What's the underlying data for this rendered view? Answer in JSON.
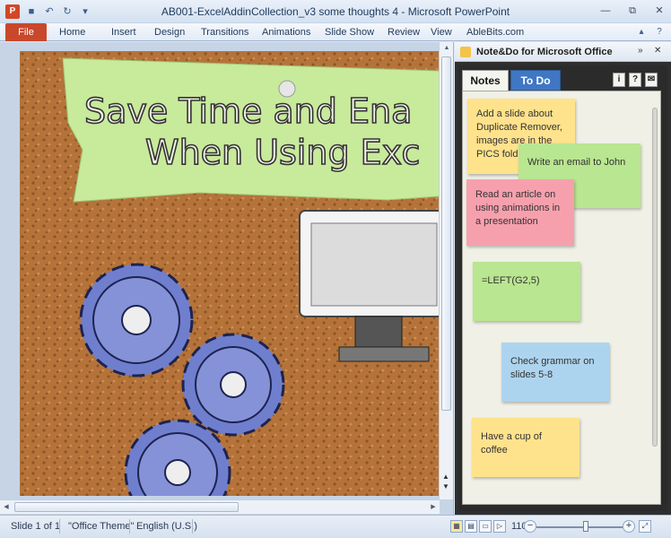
{
  "window": {
    "title": "AB001-ExcelAddinCollection_v3 some thoughts 4  -  Microsoft PowerPoint",
    "app_icon": "P"
  },
  "quick_access": {
    "icons": [
      "save-icon",
      "undo-icon",
      "redo-icon",
      "customize-qat-icon"
    ],
    "glyphs": [
      "■",
      "↶",
      "↻",
      "▾"
    ]
  },
  "window_controls": [
    "minimize-icon",
    "restore-icon",
    "close-icon"
  ],
  "window_control_glyphs": [
    "—",
    "⧉",
    "✕"
  ],
  "ribbon": {
    "file_label": "File",
    "tabs": [
      "Home",
      "Insert",
      "Design",
      "Transitions",
      "Animations",
      "Slide Show",
      "Review",
      "View",
      "AbleBits.com"
    ],
    "help_glyphs": [
      "▴",
      "?"
    ]
  },
  "slide": {
    "title_line1": "Save Time and Ena",
    "title_line2": "When Using Exc",
    "colors": {
      "cork": "#b5733a",
      "paper": "#c8ea9b",
      "gear": "#6f7fce"
    }
  },
  "pane": {
    "title": "Note&Do for Microsoft Office",
    "controls": [
      "»",
      "✕"
    ],
    "tabs": {
      "notes": "Notes",
      "todo": "To Do"
    },
    "tools": [
      "i",
      "?",
      "✉"
    ],
    "notes": [
      {
        "text": "Add a slide about Duplicate Remover, images are in the PICS folder",
        "color": "yellow"
      },
      {
        "text": "Write an email to John",
        "color": "green"
      },
      {
        "text": "Read an article on using animations in a presentation",
        "color": "pink"
      },
      {
        "text": "=LEFT(G2,5)",
        "color": "green"
      },
      {
        "text": "Check grammar on slides 5-8",
        "color": "blue"
      },
      {
        "text": "Have a cup of coffee",
        "color": "yellow"
      }
    ]
  },
  "status": {
    "slide_info": "Slide 1 of 1",
    "theme": "\"Office Theme\"",
    "language": "English (U.S.)",
    "zoom": "110%",
    "zoom_fraction": 0.54
  }
}
